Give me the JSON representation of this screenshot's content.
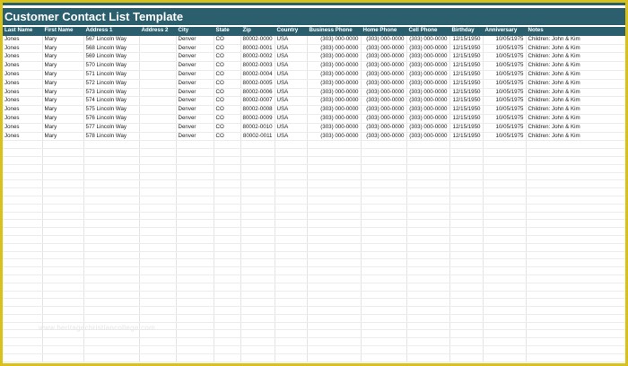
{
  "title": "Customer Contact List Template",
  "colors": {
    "header": "#2b5f6e",
    "frame": "#d8c21a"
  },
  "columns": [
    "Last Name",
    "First Name",
    "Address 1",
    "Address 2",
    "City",
    "State",
    "Zip",
    "Country",
    "Business Phone",
    "Home Phone",
    "Cell Phone",
    "Birthday",
    "Anniversary",
    "Notes"
  ],
  "rows": [
    [
      "Jones",
      "Mary",
      "567 Lincoln Way",
      "",
      "Denver",
      "CO",
      "80002-0000",
      "USA",
      "(303) 000-0000",
      "(303) 000-0000",
      "(303) 000-0000",
      "12/15/1950",
      "10/05/1975",
      "Children: John & Kim"
    ],
    [
      "Jones",
      "Mary",
      "568 Lincoln Way",
      "",
      "Denver",
      "CO",
      "80002-0001",
      "USA",
      "(303) 000-0000",
      "(303) 000-0000",
      "(303) 000-0000",
      "12/15/1950",
      "10/05/1975",
      "Children: John & Kim"
    ],
    [
      "Jones",
      "Mary",
      "569 Lincoln Way",
      "",
      "Denver",
      "CO",
      "80002-0002",
      "USA",
      "(303) 000-0000",
      "(303) 000-0000",
      "(303) 000-0000",
      "12/15/1950",
      "10/05/1975",
      "Children: John & Kim"
    ],
    [
      "Jones",
      "Mary",
      "570 Lincoln Way",
      "",
      "Denver",
      "CO",
      "80002-0003",
      "USA",
      "(303) 000-0000",
      "(303) 000-0000",
      "(303) 000-0000",
      "12/15/1950",
      "10/05/1975",
      "Children: John & Kim"
    ],
    [
      "Jones",
      "Mary",
      "571 Lincoln Way",
      "",
      "Denver",
      "CO",
      "80002-0004",
      "USA",
      "(303) 000-0000",
      "(303) 000-0000",
      "(303) 000-0000",
      "12/15/1950",
      "10/05/1975",
      "Children: John & Kim"
    ],
    [
      "Jones",
      "Mary",
      "572 Lincoln Way",
      "",
      "Denver",
      "CO",
      "80002-0005",
      "USA",
      "(303) 000-0000",
      "(303) 000-0000",
      "(303) 000-0000",
      "12/15/1950",
      "10/05/1975",
      "Children: John & Kim"
    ],
    [
      "Jones",
      "Mary",
      "573 Lincoln Way",
      "",
      "Denver",
      "CO",
      "80002-0006",
      "USA",
      "(303) 000-0000",
      "(303) 000-0000",
      "(303) 000-0000",
      "12/15/1950",
      "10/05/1975",
      "Children: John & Kim"
    ],
    [
      "Jones",
      "Mary",
      "574 Lincoln Way",
      "",
      "Denver",
      "CO",
      "80002-0007",
      "USA",
      "(303) 000-0000",
      "(303) 000-0000",
      "(303) 000-0000",
      "12/15/1950",
      "10/05/1975",
      "Children: John & Kim"
    ],
    [
      "Jones",
      "Mary",
      "575 Lincoln Way",
      "",
      "Denver",
      "CO",
      "80002-0008",
      "USA",
      "(303) 000-0000",
      "(303) 000-0000",
      "(303) 000-0000",
      "12/15/1950",
      "10/05/1975",
      "Children: John & Kim"
    ],
    [
      "Jones",
      "Mary",
      "576 Lincoln Way",
      "",
      "Denver",
      "CO",
      "80002-0009",
      "USA",
      "(303) 000-0000",
      "(303) 000-0000",
      "(303) 000-0000",
      "12/15/1950",
      "10/05/1975",
      "Children: John & Kim"
    ],
    [
      "Jones",
      "Mary",
      "577 Lincoln Way",
      "",
      "Denver",
      "CO",
      "80002-0010",
      "USA",
      "(303) 000-0000",
      "(303) 000-0000",
      "(303) 000-0000",
      "12/15/1950",
      "10/05/1975",
      "Children: John & Kim"
    ],
    [
      "Jones",
      "Mary",
      "578 Lincoln Way",
      "",
      "Denver",
      "CO",
      "80002-0011",
      "USA",
      "(303) 000-0000",
      "(303) 000-0000",
      "(303) 000-0000",
      "12/15/1950",
      "10/05/1975",
      "Children: John & Kim"
    ]
  ],
  "empty_row_count": 28,
  "watermark": "www.heritagechristiancollege.com"
}
